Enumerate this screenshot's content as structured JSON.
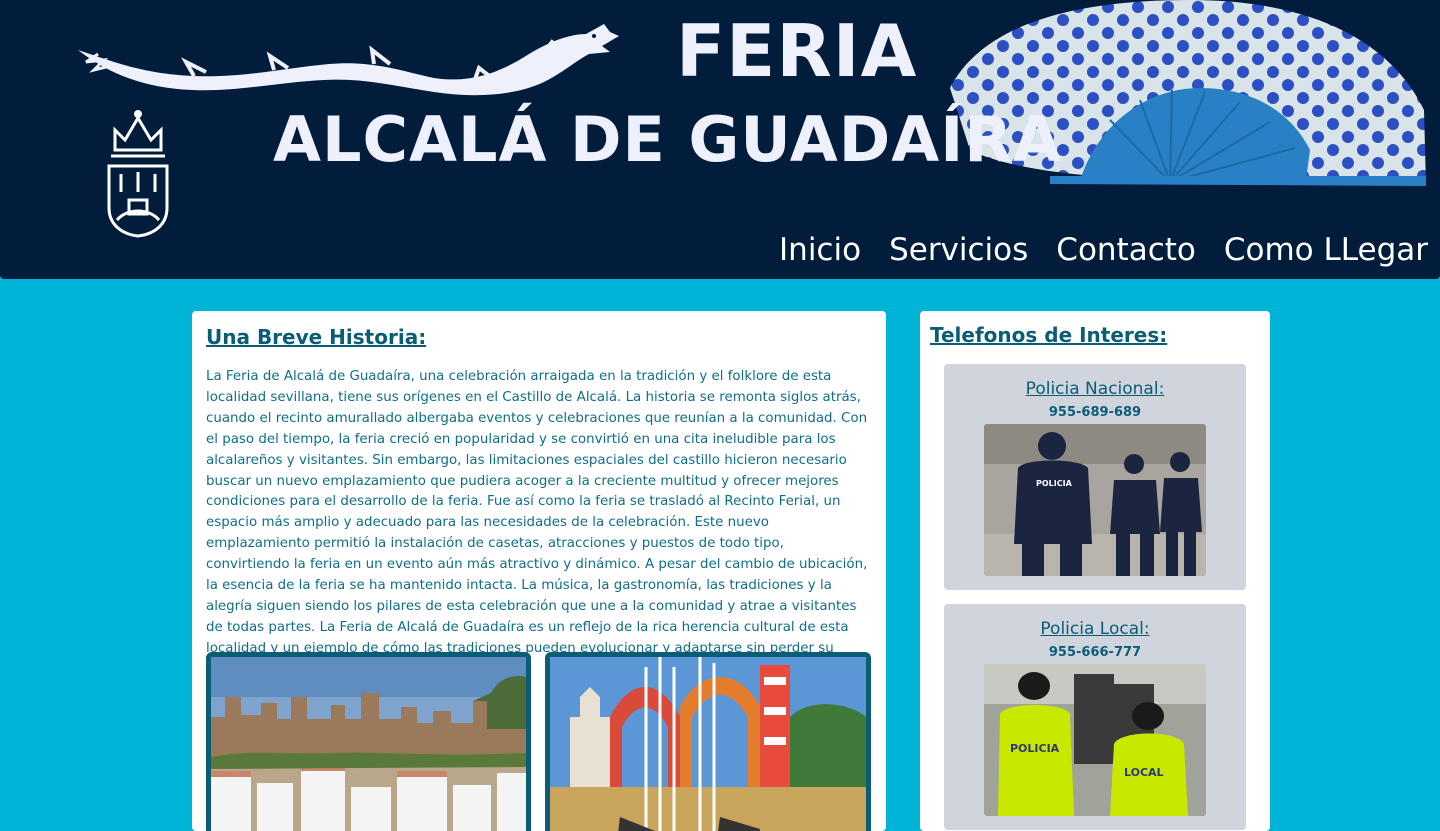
{
  "header": {
    "title_feria": "FERIA",
    "title_town": "ALCALÁ DE GUADAÍRA",
    "nav": [
      "Inicio",
      "Servicios",
      "Contacto",
      "Como LLegar"
    ]
  },
  "history": {
    "heading": "Una Breve Historia:",
    "body": "La Feria de Alcalá de Guadaíra, una celebración arraigada en la tradición y el folklore de esta localidad sevillana, tiene sus orígenes en el Castillo de Alcalá. La historia se remonta siglos atrás, cuando el recinto amurallado albergaba eventos y celebraciones que reunían a la comunidad. Con el paso del tiempo, la feria creció en popularidad y se convirtió en una cita ineludible para los alcalareños y visitantes. Sin embargo, las limitaciones espaciales del castillo hicieron necesario buscar un nuevo emplazamiento que pudiera acoger a la creciente multitud y ofrecer mejores condiciones para el desarrollo de la feria. Fue así como la feria se trasladó al Recinto Ferial, un espacio más amplio y adecuado para las necesidades de la celebración. Este nuevo emplazamiento permitió la instalación de casetas, atracciones y puestos de todo tipo, convirtiendo la feria en un evento aún más atractivo y dinámico. A pesar del cambio de ubicación, la esencia de la feria se ha mantenido intacta. La música, la gastronomía, las tradiciones y la alegría siguen siendo los pilares de esta celebración que une a la comunidad y atrae a visitantes de todas partes. La Feria de Alcalá de Guadaíra es un reflejo de la rica herencia cultural de esta localidad y un ejemplo de cómo las tradiciones pueden evolucionar y adaptarse sin perder su esencia."
  },
  "phones": {
    "heading": "Telefonos de Interes:",
    "contacts": [
      {
        "name": "Policia Nacional:",
        "phone": "955-689-689"
      },
      {
        "name": "Policia Local:",
        "phone": "955-666-777"
      }
    ]
  },
  "images": {
    "vest_text_1": "POLICIA",
    "vest_text_2": "LOCAL",
    "badge_text": "POLICIA"
  },
  "colors": {
    "page_background": "#00b4d8",
    "header_background": "#021c3b",
    "heading": "#0b5d75",
    "body_text": "#0f6e86",
    "contact_card": "#d0d4dd"
  },
  "icons": [
    "dragon-logo",
    "coat-of-arms-icon",
    "flamenco-fan-image"
  ]
}
